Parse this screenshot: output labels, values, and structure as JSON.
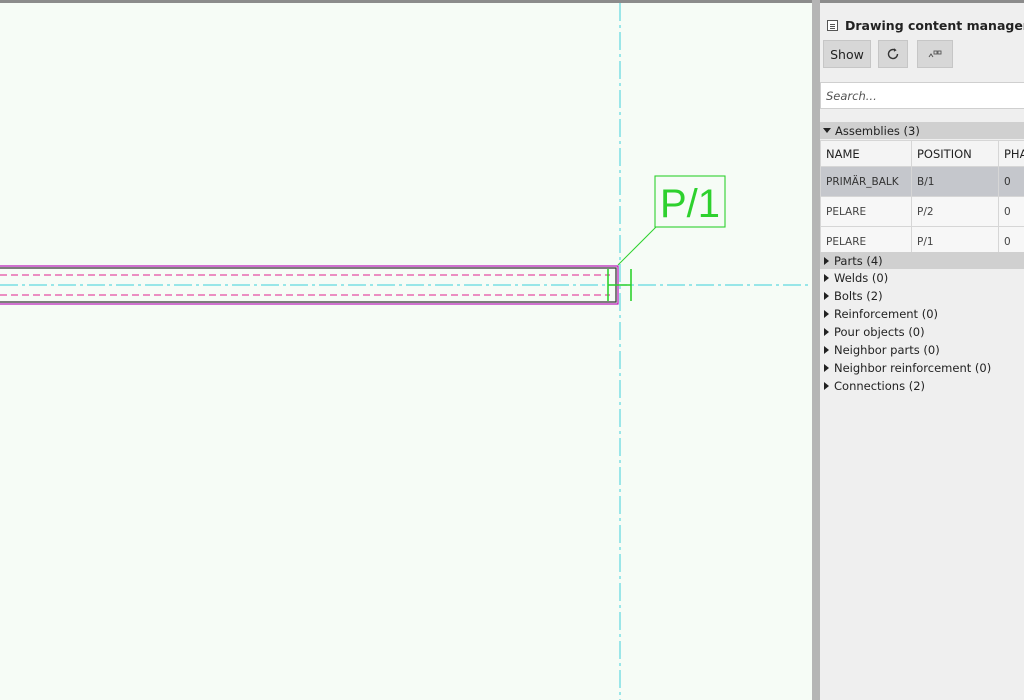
{
  "panel": {
    "title": "Drawing content manager",
    "show_label": "Show",
    "search_placeholder": "Search...",
    "assemblies_header": "Assemblies (3)",
    "columns": [
      "NAME",
      "POSITION",
      "PHA"
    ],
    "rows": [
      {
        "name": "PRIMÄR_BALK",
        "position": "B/1",
        "phase": "0",
        "selected": true
      },
      {
        "name": "PELARE",
        "position": "P/2",
        "phase": "0",
        "selected": false
      },
      {
        "name": "PELARE",
        "position": "P/1",
        "phase": "0",
        "selected": false
      }
    ],
    "tree": [
      "Parts (4)",
      "Welds (0)",
      "Bolts (2)",
      "Reinforcement (0)",
      "Pour objects (0)",
      "Neighbor parts (0)",
      "Neighbor reinforcement (0)",
      "Connections (2)"
    ]
  },
  "drawing": {
    "mark_label": "P/1",
    "colors": {
      "gridline": "#5fd8e0",
      "part_outline": "#3a3a3a",
      "hidden_line": "#e0208f",
      "magenta": "#b200b2",
      "mark_green": "#2ed12e",
      "background": "#f6fcf6"
    }
  },
  "icons": {
    "title": "panel-icon",
    "refresh": "refresh-icon",
    "options": "filter-options-icon"
  }
}
